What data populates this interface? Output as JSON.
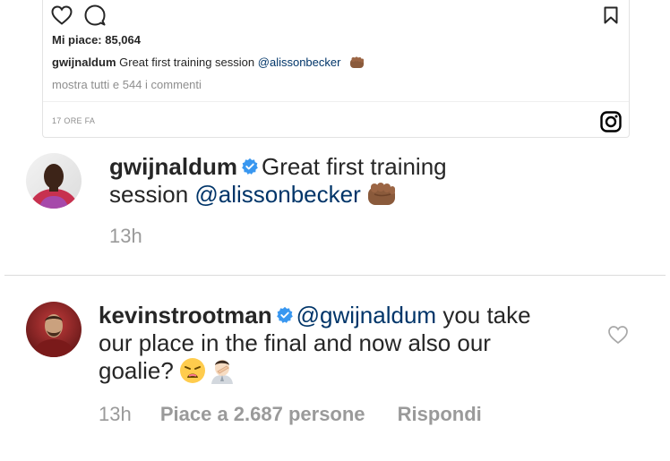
{
  "embed": {
    "likes": "Mi piace: 85,064",
    "caption_user": "gwijnaldum",
    "caption_text": "Great first training session",
    "caption_mention": "@alissonbecker",
    "view_all": "mostra tutti e 544 i commenti",
    "timestamp": "17 ORE FA",
    "icons": [
      "heart-outline-icon",
      "comment-bubble-icon",
      "bookmark-icon",
      "instagram-logo-icon"
    ]
  },
  "post": {
    "username": "gwijnaldum",
    "text": "Great first training session",
    "mention": "@alissonbecker",
    "emoji": "fist-bump-emoji",
    "time": "13h"
  },
  "comment": {
    "username": "kevinstrootman",
    "mention": "@gwijnaldum",
    "text": "you take our place in the final and now also our goalie?",
    "emojis": [
      "weary-face-emoji",
      "facepalm-emoji"
    ],
    "time": "13h",
    "likes_label": "Piace a 2.687 persone",
    "reply_label": "Rispondi"
  },
  "colors": {
    "mention": "#003569",
    "verified": "#3897f0",
    "muted": "#8e8e8e"
  }
}
